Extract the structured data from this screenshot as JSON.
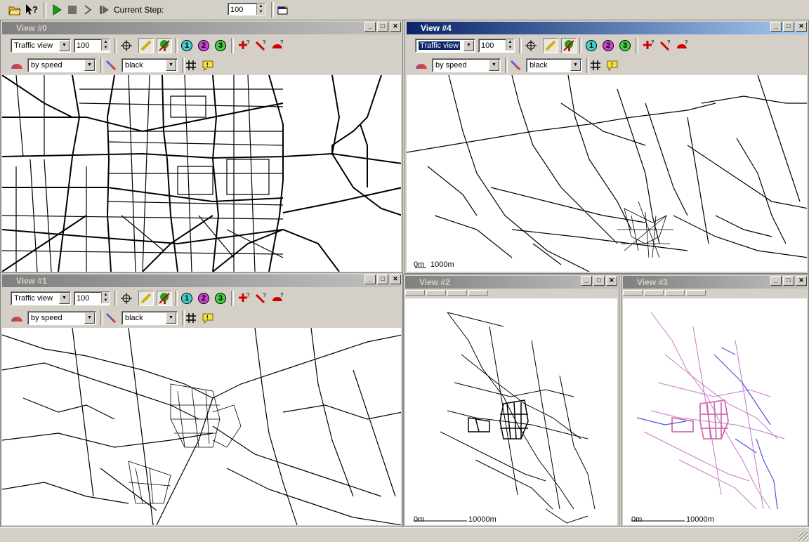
{
  "main_toolbar": {
    "icons": [
      "open-folder-icon",
      "help-pointer-icon",
      "play-icon",
      "stop-icon",
      "step-forward-icon",
      "fast-step-icon",
      "new-view-icon"
    ],
    "current_step_label": "Current Step:",
    "current_step_value": "100"
  },
  "views": [
    {
      "title": "View #0",
      "active": false,
      "view_mode": "Traffic view",
      "zoom": "100",
      "color_scheme": "by speed",
      "color_value": "black",
      "scale": {
        "start": "",
        "end": ""
      }
    },
    {
      "title": "View #4",
      "active": true,
      "view_mode": "Traffic view",
      "zoom": "100",
      "color_scheme": "by speed",
      "color_value": "black",
      "scale": {
        "start": "0m",
        "end": "1000m"
      }
    },
    {
      "title": "View #1",
      "active": false,
      "view_mode": "Traffic view",
      "zoom": "100",
      "color_scheme": "by speed",
      "color_value": "black",
      "scale": {
        "start": "",
        "end": ""
      }
    },
    {
      "title": "View #2",
      "active": false,
      "scale": {
        "start": "0m",
        "end": "10000m"
      }
    },
    {
      "title": "View #3",
      "active": false,
      "scale": {
        "start": "0m",
        "end": "10000m"
      }
    }
  ],
  "window_buttons": {
    "minimize": "_",
    "maximize": "□",
    "close": "✕"
  },
  "colors": {
    "active_title": "#0a246a",
    "network_line": "#000000",
    "speed_pink": "#c878c8",
    "speed_blue": "#5050e0"
  }
}
